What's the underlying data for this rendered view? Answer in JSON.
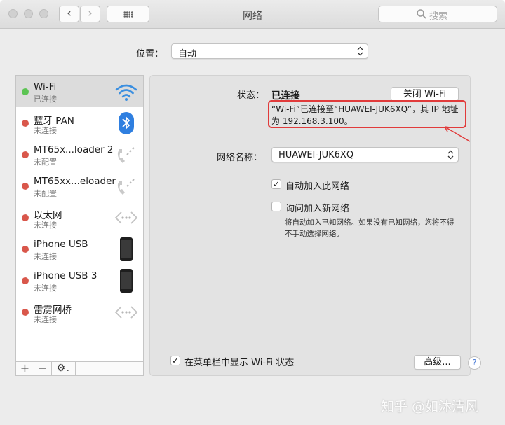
{
  "window": {
    "title": "网络",
    "search_placeholder": "搜索",
    "back_glyph": "‹",
    "forward_glyph": "›"
  },
  "location": {
    "label": "位置：",
    "value": "自动"
  },
  "services": [
    {
      "name": "Wi-Fi",
      "status": "已连接",
      "color": "#5cc453",
      "icon": "wifi-icon",
      "selected": true
    },
    {
      "name": "蓝牙 PAN",
      "status": "未连接",
      "color": "#d9574b",
      "icon": "bluetooth-icon"
    },
    {
      "name": "MT65x...loader 2",
      "status": "未配置",
      "color": "#d9574b",
      "icon": "phone-icon"
    },
    {
      "name": "MT65xx...eloader",
      "status": "未配置",
      "color": "#d9574b",
      "icon": "phone-icon"
    },
    {
      "name": "以太网",
      "status": "未连接",
      "color": "#d9574b",
      "icon": "ethernet-icon"
    },
    {
      "name": "iPhone USB",
      "status": "未连接",
      "color": "#d9574b",
      "icon": "iphone-icon"
    },
    {
      "name": "iPhone USB 3",
      "status": "未连接",
      "color": "#d9574b",
      "icon": "iphone-icon"
    },
    {
      "name": "雷雳网桥",
      "status": "未连接",
      "color": "#d9574b",
      "icon": "ethernet-icon"
    }
  ],
  "sidebar_buttons": {
    "add": "+",
    "remove": "−",
    "action": "⚙"
  },
  "detail": {
    "status_label": "状态：",
    "status_value": "已连接",
    "status_desc": "“Wi-Fi”已连接至“HUAWEI-JUK6XQ”，其 IP 地址为 192.168.3.100。",
    "turn_off_button": "关闭 Wi-Fi",
    "network_name_label": "网络名称：",
    "network_name_value": "HUAWEI-JUK6XQ",
    "auto_join_label": "自动加入此网络",
    "auto_join_checked": true,
    "ask_join_label": "询问加入新网络",
    "ask_join_checked": false,
    "ask_join_note": "将自动加入已知网络。如果没有已知网络，您将不得不手动选择网络。",
    "show_menubar_label": "在菜单栏中显示 Wi-Fi 状态",
    "show_menubar_checked": true,
    "advanced_button": "高级...",
    "help_glyph": "?"
  },
  "watermark": "知乎 @如沐清风",
  "accent_color": "#e13b3b"
}
